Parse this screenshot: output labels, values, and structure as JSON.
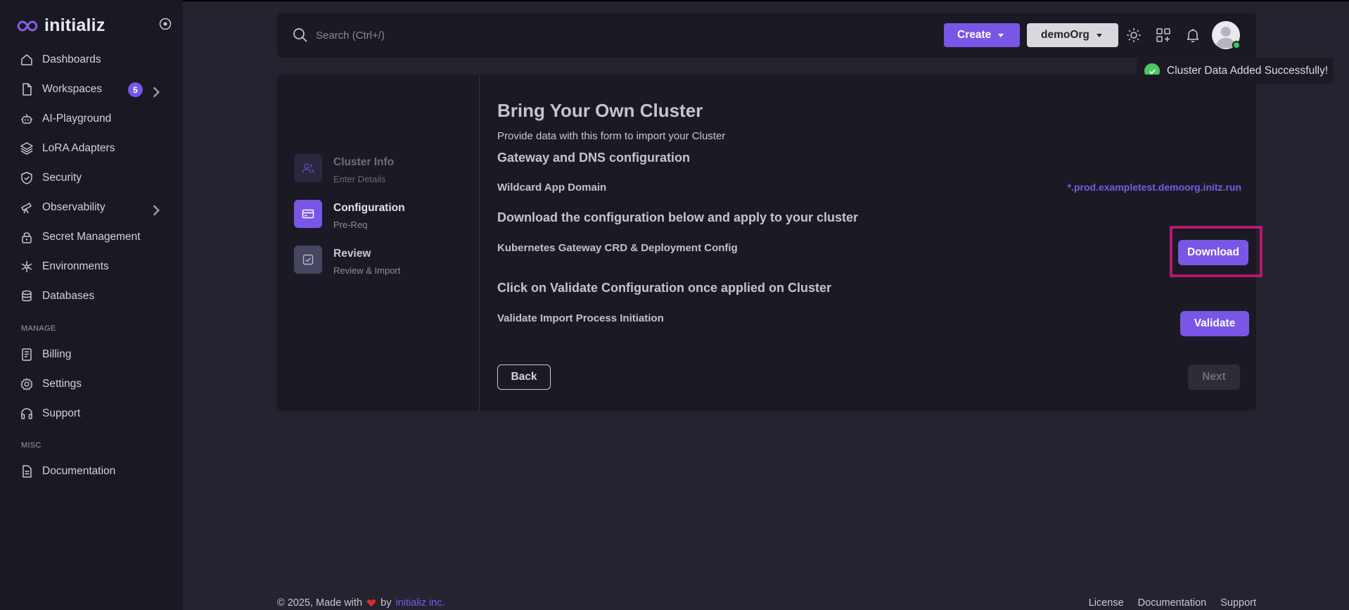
{
  "brand": {
    "name": "initializ"
  },
  "sidebar": {
    "items": [
      {
        "label": "Dashboards",
        "icon": "home-icon"
      },
      {
        "label": "Workspaces",
        "icon": "file-icon",
        "badge": "5"
      },
      {
        "label": "AI-Playground",
        "icon": "robot-icon"
      },
      {
        "label": "LoRA Adapters",
        "icon": "layers-icon"
      },
      {
        "label": "Security",
        "icon": "shield-icon"
      },
      {
        "label": "Observability",
        "icon": "telescope-icon"
      },
      {
        "label": "Secret Management",
        "icon": "lock-icon"
      },
      {
        "label": "Environments",
        "icon": "snowflake-icon"
      },
      {
        "label": "Databases",
        "icon": "database-icon"
      }
    ],
    "manage_label": "MANAGE",
    "manage_items": [
      {
        "label": "Billing",
        "icon": "receipt-icon"
      },
      {
        "label": "Settings",
        "icon": "gear-icon"
      },
      {
        "label": "Support",
        "icon": "headphones-icon"
      }
    ],
    "misc_label": "MISC",
    "misc_items": [
      {
        "label": "Documentation",
        "icon": "document-icon"
      }
    ]
  },
  "topbar": {
    "search_placeholder": "Search (Ctrl+/)",
    "create_label": "Create",
    "org_label": "demoOrg"
  },
  "toast": {
    "message": "Cluster Data Added Successfully!"
  },
  "stepper": {
    "steps": [
      {
        "title": "Cluster Info",
        "subtitle": "Enter Details",
        "state": "completed"
      },
      {
        "title": "Configuration",
        "subtitle": "Pre-Req",
        "state": "active"
      },
      {
        "title": "Review",
        "subtitle": "Review & Import",
        "state": "pending"
      }
    ]
  },
  "form": {
    "title": "Bring Your Own Cluster",
    "description": "Provide data with this form to import your Cluster",
    "gateway_heading": "Gateway and DNS configuration",
    "wildcard_label": "Wildcard App Domain",
    "wildcard_value": "*.prod.exampletest.demoorg.initz.run",
    "download_heading": "Download the configuration below and apply to your cluster",
    "config_label": "Kubernetes Gateway CRD & Deployment Config",
    "download_button": "Download",
    "validate_heading": "Click on Validate Configuration once applied on Cluster",
    "validate_label": "Validate Import Process Initiation",
    "validate_button": "Validate",
    "back_button": "Back",
    "next_button": "Next"
  },
  "footer": {
    "copyright": "© 2025, Made with",
    "by": "by",
    "company": "initializ inc.",
    "links": [
      "License",
      "Documentation",
      "Support"
    ]
  },
  "colors": {
    "accent": "#7a56e6",
    "highlight": "#b4196d",
    "success": "#4bc764",
    "background": "#25232f",
    "panel": "#1b1a24"
  }
}
